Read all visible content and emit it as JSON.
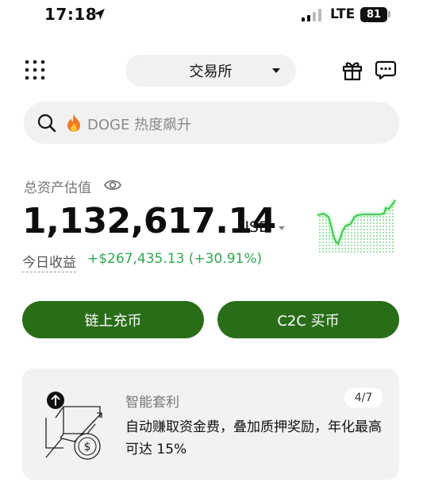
{
  "status_bar": {
    "time": "17:18",
    "network": "LTE",
    "battery": "81"
  },
  "nav": {
    "exchange_label": "交易所"
  },
  "search": {
    "placeholder": "DOGE 热度飙升"
  },
  "assets": {
    "label": "总资产估值",
    "value": "1,132,617.14",
    "currency": "USD",
    "pnl_label": "今日收益",
    "pnl_value": "+$267,435.13 (+30.91%)"
  },
  "actions": {
    "deposit_label": "链上充币",
    "c2c_label": "C2C 买币"
  },
  "promo": {
    "title": "智能套利",
    "page": "4/7",
    "description": "自动赚取资金费，叠加质押奖励，年化最高可达 15%"
  },
  "colors": {
    "accent_green": "#2a6d19",
    "profit_green": "#2fa84f",
    "surface": "#f1f1f1"
  },
  "icons": [
    "location-arrow-icon",
    "signal-icon",
    "grid-menu-icon",
    "gift-icon",
    "chat-icon",
    "search-icon",
    "fire-icon",
    "eye-icon",
    "dollar-coin-icon",
    "arrow-up-icon"
  ]
}
